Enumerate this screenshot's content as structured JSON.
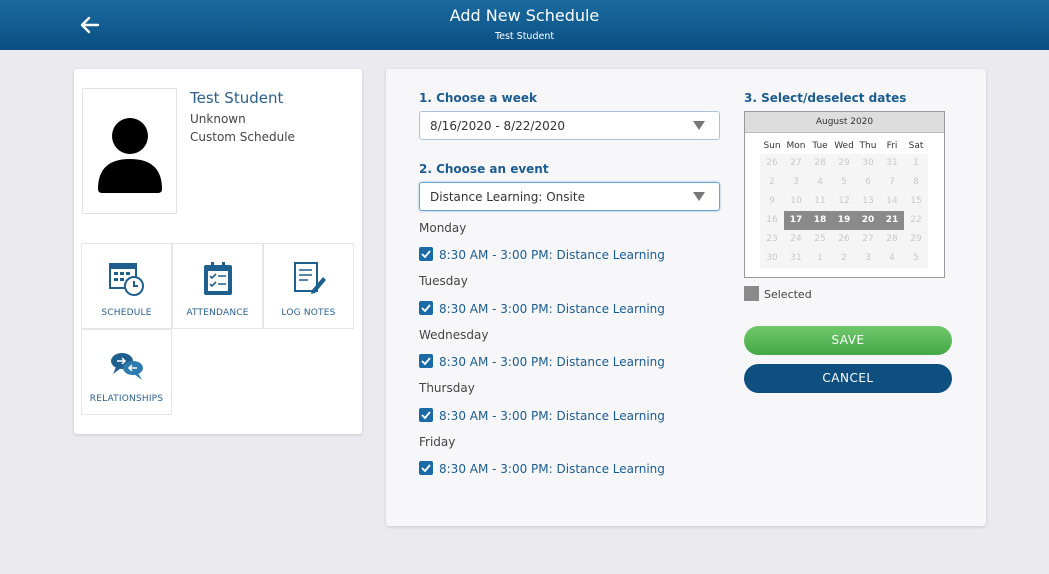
{
  "header": {
    "title": "Add New Schedule",
    "subtitle": "Test Student"
  },
  "student": {
    "name": "Test Student",
    "line1": "Unknown",
    "line2": "Custom Schedule"
  },
  "tiles": [
    {
      "label": "SCHEDULE",
      "icon": "schedule-icon"
    },
    {
      "label": "ATTENDANCE",
      "icon": "attendance-icon"
    },
    {
      "label": "LOG NOTES",
      "icon": "log-notes-icon"
    },
    {
      "label": "RELATIONSHIPS",
      "icon": "relationships-icon"
    }
  ],
  "form": {
    "week_label": "1. Choose a week",
    "week_value": "8/16/2020 - 8/22/2020",
    "event_label": "2. Choose an event",
    "event_value": "Distance Learning: Onsite",
    "dates_label": "3. Select/deselect dates",
    "days": [
      {
        "day": "Monday",
        "event": "8:30 AM - 3:00 PM: Distance Learning",
        "checked": true
      },
      {
        "day": "Tuesday",
        "event": "8:30 AM - 3:00 PM: Distance Learning",
        "checked": true
      },
      {
        "day": "Wednesday",
        "event": "8:30 AM - 3:00 PM: Distance Learning",
        "checked": true
      },
      {
        "day": "Thursday",
        "event": "8:30 AM - 3:00 PM: Distance Learning",
        "checked": true
      },
      {
        "day": "Friday",
        "event": "8:30 AM - 3:00 PM: Distance Learning",
        "checked": true
      }
    ]
  },
  "calendar": {
    "month": "August 2020",
    "dow": [
      "Sun",
      "Mon",
      "Tue",
      "Wed",
      "Thu",
      "Fri",
      "Sat"
    ],
    "weeks": [
      [
        "26",
        "27",
        "28",
        "29",
        "30",
        "31",
        "1"
      ],
      [
        "2",
        "3",
        "4",
        "5",
        "6",
        "7",
        "8"
      ],
      [
        "9",
        "10",
        "11",
        "12",
        "13",
        "14",
        "15"
      ],
      [
        "16",
        "17",
        "18",
        "19",
        "20",
        "21",
        "22"
      ],
      [
        "23",
        "24",
        "25",
        "26",
        "27",
        "28",
        "29"
      ],
      [
        "30",
        "31",
        "1",
        "2",
        "3",
        "4",
        "5"
      ]
    ],
    "selected": [
      "17",
      "18",
      "19",
      "20",
      "21"
    ],
    "legend": "Selected",
    "selected_color": "#8a8a8a"
  },
  "buttons": {
    "save": "SAVE",
    "cancel": "CANCEL"
  },
  "colors": {
    "header": "#0a4f82",
    "accent": "#1b5c8f",
    "save": "#45a847",
    "cancel": "#0e4f80"
  }
}
